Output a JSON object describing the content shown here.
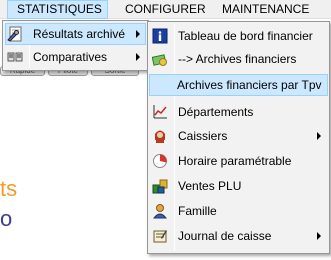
{
  "menubar": {
    "items": [
      {
        "label": "STATISTIQUES"
      },
      {
        "label": "CONFIGURER"
      },
      {
        "label": "MAINTENANCE"
      }
    ]
  },
  "background": {
    "buttons": [
      "Rapide",
      "Pilote",
      "Sortie"
    ],
    "text1": "ts",
    "text2": "o"
  },
  "menu_stats": {
    "items": [
      {
        "label": "Résultats archivé",
        "icon": "wrench-page-icon",
        "has_submenu": true,
        "highlighted": true
      },
      {
        "label": "Comparatives",
        "icon": "comparison-icon",
        "has_submenu": true,
        "highlighted": false
      }
    ]
  },
  "submenu": {
    "items": [
      {
        "label": "Tableau de bord financier",
        "icon": "info-icon",
        "has_submenu": false
      },
      {
        "label": "--> Archives financiers",
        "icon": "money-icon",
        "has_submenu": false
      },
      {
        "label": "Archives financiers par Tpv",
        "icon": "",
        "has_submenu": false,
        "highlighted": true
      },
      {
        "label": "Départements",
        "icon": "line-chart-icon",
        "has_submenu": false
      },
      {
        "label": "Caissiers",
        "icon": "cashier-icon",
        "has_submenu": true
      },
      {
        "label": "Horaire paramétrable",
        "icon": "clock-pie-icon",
        "has_submenu": false
      },
      {
        "label": "Ventes PLU",
        "icon": "products-icon",
        "has_submenu": false
      },
      {
        "label": "Famille",
        "icon": "person-icon",
        "has_submenu": false
      },
      {
        "label": "Journal de caisse",
        "icon": "journal-icon",
        "has_submenu": true
      }
    ]
  },
  "colors": {
    "menu_bg": "#f2f2f2",
    "highlight_bg": "#cce8ff",
    "highlight_border": "#99d1ff"
  }
}
